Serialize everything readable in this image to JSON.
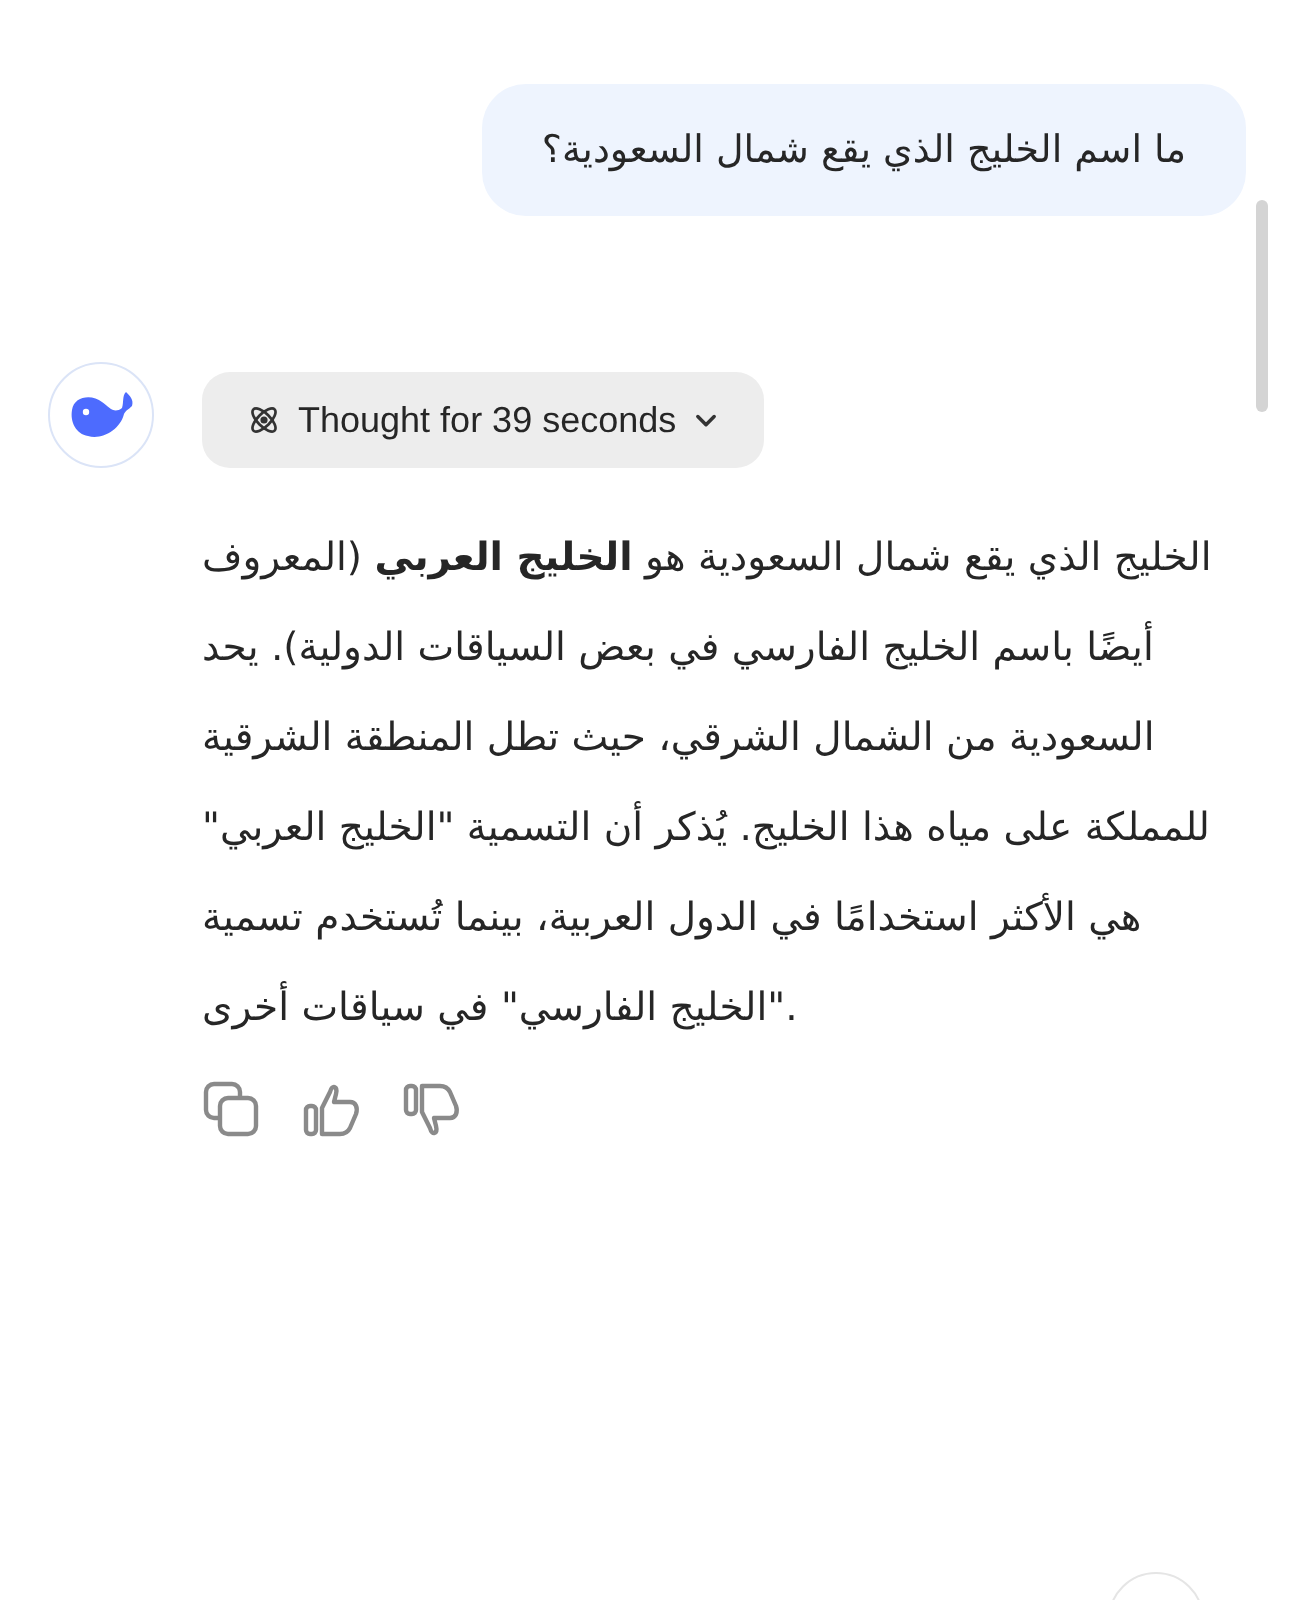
{
  "user_message": {
    "text": "ما اسم الخليج الذي يقع شمال السعودية؟"
  },
  "assistant": {
    "thought": {
      "label": "Thought for 39 seconds",
      "expanded": false
    },
    "answer": "الخليج الذي يقع شمال السعودية هو **الخليج العربي** (المعروف أيضًا باسم الخليج الفارسي في بعض السياقات الدولية). يحد السعودية من الشمال الشرقي، حيث تطل المنطقة الشرقية للمملكة على مياه هذا الخليج. يُذكر أن التسمية \"الخليج العربي\" هي الأكثر استخدامًا في الدول العربية، بينما تُستخدم تسمية \"الخليج الفارسي\" في سياقات أخرى."
  }
}
